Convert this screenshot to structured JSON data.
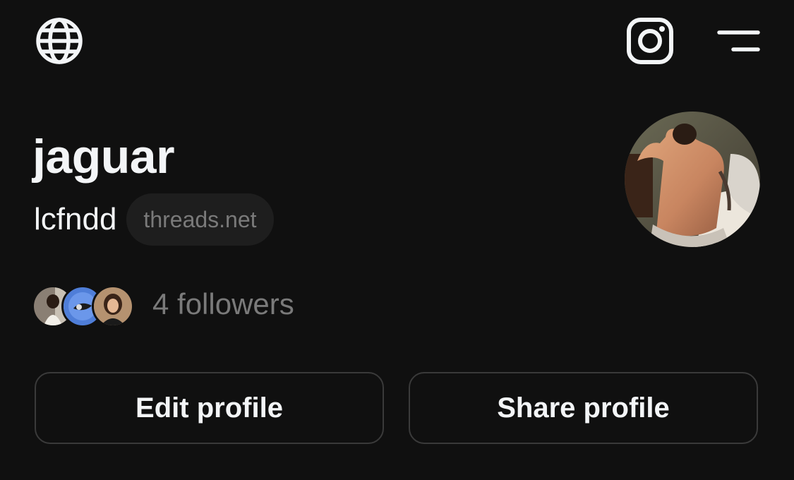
{
  "header": {
    "left_icon": "globe-icon",
    "right_icons": [
      "instagram-icon",
      "menu-icon"
    ]
  },
  "profile": {
    "display_name": "jaguar",
    "username": "lcfndd",
    "domain_badge": "threads.net",
    "avatar": "profile-photo"
  },
  "followers": {
    "avatars": [
      "follower-avatar-1",
      "follower-avatar-2",
      "follower-avatar-3"
    ],
    "label": "4 followers"
  },
  "actions": {
    "edit_label": "Edit profile",
    "share_label": "Share profile"
  },
  "colors": {
    "background": "#101010",
    "primary_text": "#f3f5f7",
    "secondary_text": "#7a7a7a",
    "pill_background": "#1e1e1e",
    "button_border": "#3a3a3a"
  }
}
